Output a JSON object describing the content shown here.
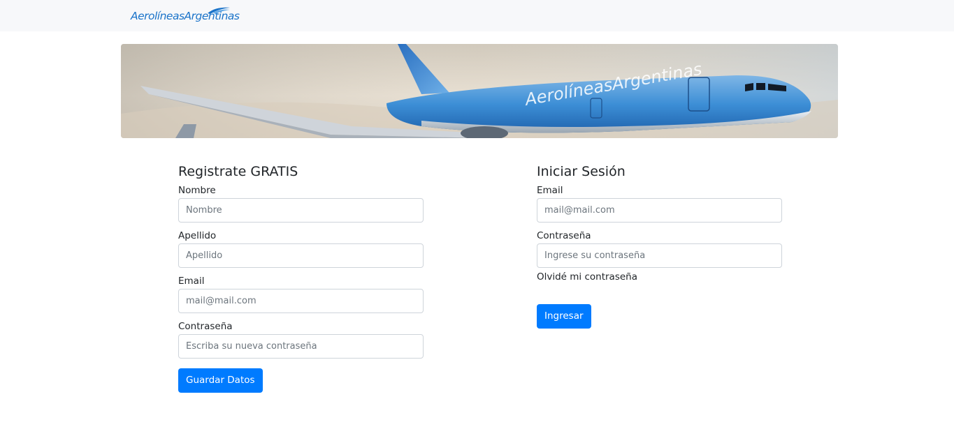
{
  "header": {
    "logo_text": "AerolíneasArgentinas"
  },
  "hero": {
    "livery_text": "AerolíneasArgentinas"
  },
  "register": {
    "title": "Registrate GRATIS",
    "nombre_label": "Nombre",
    "nombre_placeholder": "Nombre",
    "apellido_label": "Apellido",
    "apellido_placeholder": "Apellido",
    "email_label": "Email",
    "email_placeholder": "mail@mail.com",
    "password_label": "Contraseña",
    "password_placeholder": "Escriba su nueva contraseña",
    "submit_label": "Guardar Datos"
  },
  "login": {
    "title": "Iniciar Sesión",
    "email_label": "Email",
    "email_placeholder": "mail@mail.com",
    "password_label": "Contraseña",
    "password_placeholder": "Ingrese su contraseña",
    "forgot_label": "Olvidé mi contraseña",
    "submit_label": "Ingresar"
  },
  "colors": {
    "primary": "#007bff",
    "navbar_bg": "#f7f8fa",
    "brand_blue": "#1a73c9"
  }
}
